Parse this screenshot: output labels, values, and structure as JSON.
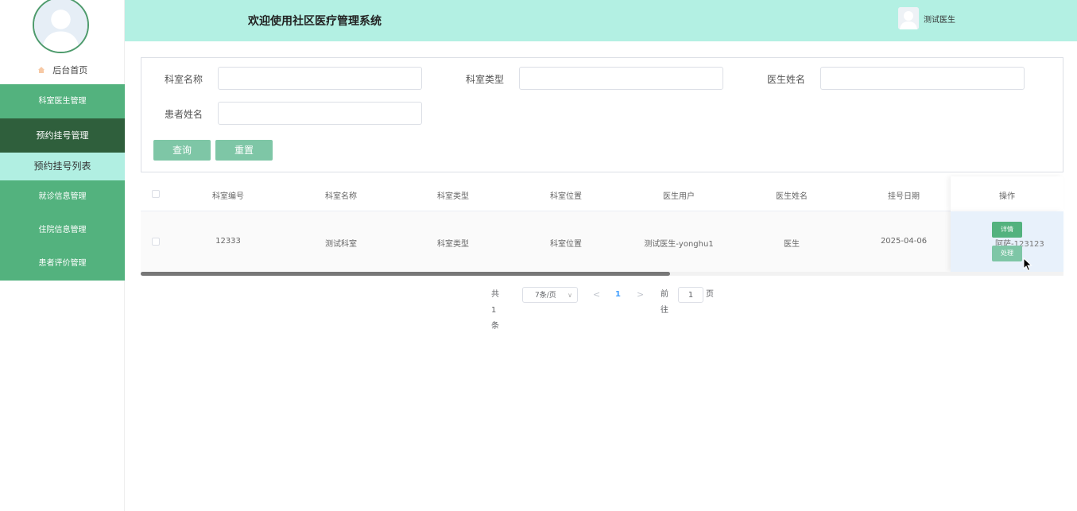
{
  "header": {
    "title": "欢迎使用社区医疗管理系统",
    "user_name": "测试医生"
  },
  "sidebar": {
    "home": "后台首页",
    "items": [
      {
        "label": "科室医生管理"
      },
      {
        "label": "预约挂号管理"
      },
      {
        "label": "预约挂号列表"
      },
      {
        "label": "就诊信息管理"
      },
      {
        "label": "住院信息管理"
      },
      {
        "label": "患者评价管理"
      }
    ]
  },
  "search": {
    "fields": [
      {
        "label": "科室名称",
        "value": ""
      },
      {
        "label": "科室类型",
        "value": ""
      },
      {
        "label": "医生姓名",
        "value": ""
      },
      {
        "label": "患者姓名",
        "value": ""
      }
    ],
    "query_button": "查询",
    "reset_button": "重置"
  },
  "table": {
    "columns": [
      "科室编号",
      "科室名称",
      "科室类型",
      "科室位置",
      "医生用户",
      "医生姓名",
      "挂号日期",
      "操作"
    ],
    "rows": [
      {
        "cells": [
          "12333",
          "测试科室",
          "科室类型",
          "科室位置",
          "测试医生-yonghu1",
          "医生",
          "2025-04-06"
        ],
        "hidden": "阿萨-123123"
      }
    ],
    "actions": {
      "detail": "详情",
      "handle": "处理"
    }
  },
  "pagination": {
    "total": "共 1 条",
    "page_size": "7条/页",
    "prev": "<",
    "current": "1",
    "next": ">",
    "goto_prefix": "前往",
    "goto_value": "1",
    "goto_suffix": "页"
  }
}
